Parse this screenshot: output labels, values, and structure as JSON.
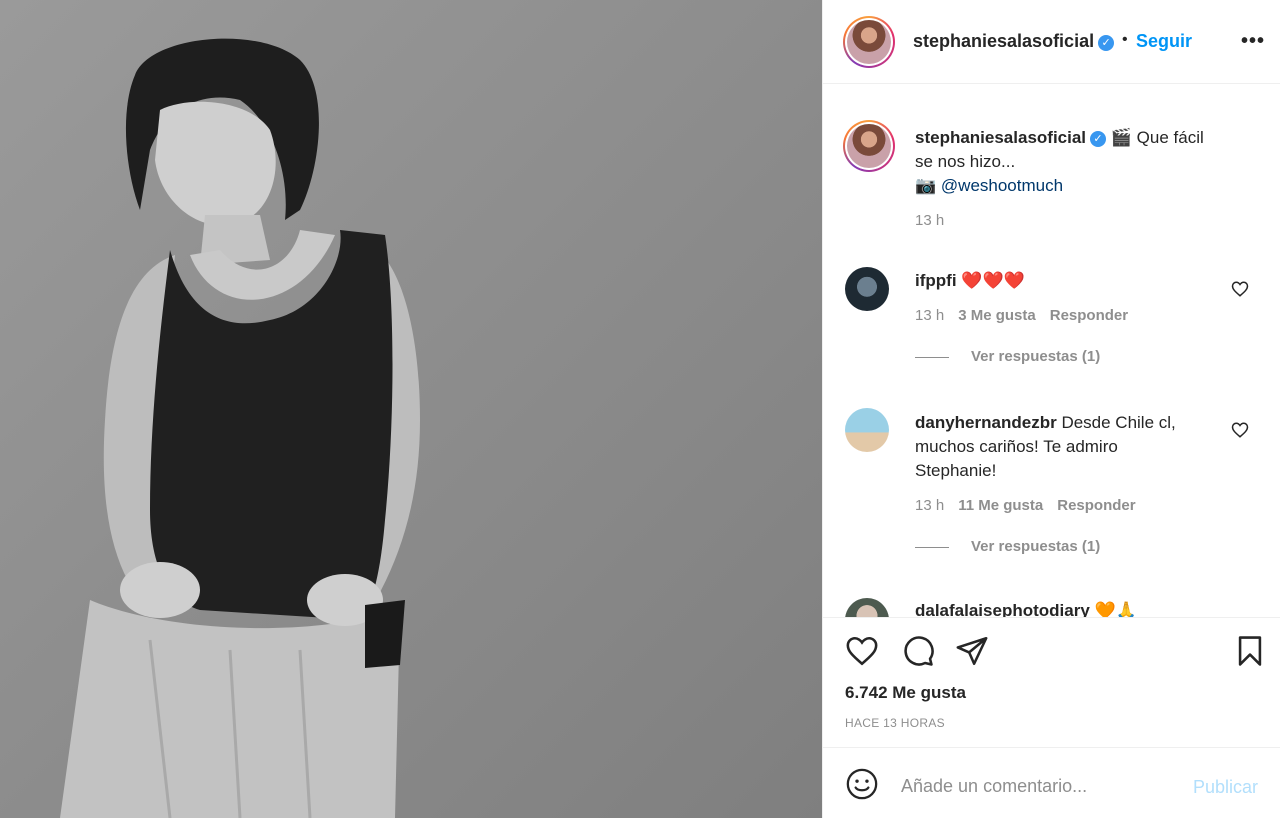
{
  "post": {
    "username": "stephaniesalasoficial",
    "follow_label": "Seguir",
    "separator": "•",
    "more_label": "•••",
    "caption": {
      "emoji": "🎬",
      "text_line1": "Que fácil",
      "text_line2": "se nos hizo...",
      "camera_emoji": "📷",
      "mention": "@weshootmuch",
      "time": "13 h"
    },
    "comments": [
      {
        "username": "ifppfi",
        "text": "❤️❤️❤️",
        "time": "13 h",
        "likes": "3 Me gusta",
        "reply": "Responder",
        "view_replies": "Ver respuestas (1)"
      },
      {
        "username": "danyhernandezbr",
        "text_line1": "Desde Chile cl,",
        "text_line2": "muchos cariños! Te admiro",
        "text_line3": "Stephanie!",
        "time": "13 h",
        "likes": "11 Me gusta",
        "reply": "Responder",
        "view_replies": "Ver respuestas (1)"
      },
      {
        "username": "dalafalaisephotodiary",
        "text": "🧡🙏"
      }
    ],
    "likes_count": "6.742 Me gusta",
    "time_ago": "HACE 13 HORAS",
    "comment_placeholder": "Añade un comentario...",
    "publish_label": "Publicar"
  },
  "colors": {
    "accent": "#0095f6",
    "verified": "#3897f0",
    "publish_disabled": "#b2dffc",
    "heart_red": "#e0245e"
  }
}
